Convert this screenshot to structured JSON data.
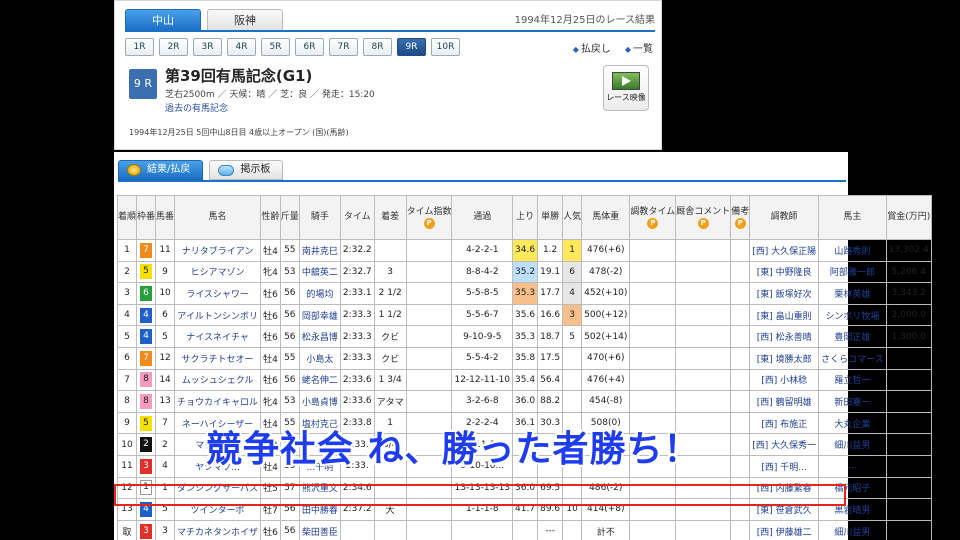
{
  "venue_tabs": [
    {
      "label": "中山",
      "active": true
    },
    {
      "label": "阪神",
      "active": false
    }
  ],
  "result_date": "1994年12月25日のレース結果",
  "race_tabs": [
    "1R",
    "2R",
    "3R",
    "4R",
    "5R",
    "6R",
    "7R",
    "8R",
    "9R",
    "10R"
  ],
  "active_race_tab": "9R",
  "links": {
    "payout": "払戻し",
    "list": "一覧"
  },
  "race": {
    "number": "9 R",
    "title": "第39回有馬記念(G1)",
    "subtitle": "芝右2500m ／ 天候：晴 ／ 芝：良 ／ 発走：15:20",
    "past_link": "過去の有馬記念",
    "info": "1994年12月25日 5回中山8日目 4歳以上オープン (国)(馬齢)"
  },
  "video_button": {
    "label": "レース映像",
    "icon": "video-thumbnail-icon"
  },
  "section_tabs": [
    {
      "label": "結果/払戻",
      "icon": "coin-icon",
      "active": true
    },
    {
      "label": "掲示板",
      "icon": "speech-bubble-icon",
      "active": false
    }
  ],
  "table": {
    "headers": [
      "着順",
      "枠番",
      "馬番",
      "馬名",
      "性齢",
      "斤量",
      "騎手",
      "タイム",
      "着差",
      "タイム指数",
      "通過",
      "上り",
      "単勝",
      "人気",
      "馬体重",
      "調教タイム",
      "厩舎コメント",
      "備考",
      "調教師",
      "馬主",
      "賞金(万円)"
    ],
    "premium_badge": "P",
    "rows": [
      [
        "1",
        "7",
        "11",
        "ナリタブライアン",
        "牡4",
        "55",
        "南井克巳",
        "2:32.2",
        "",
        "",
        "4-2-2-1",
        "34.6",
        "1.2",
        "1",
        "476(+6)",
        "",
        "",
        "",
        "[西] 大久保正陽",
        "山路秀則",
        "13,302.4"
      ],
      [
        "2",
        "5",
        "9",
        "ヒシアマゾン",
        "牝4",
        "53",
        "中舘英二",
        "2:32.7",
        "3",
        "",
        "8-8-4-2",
        "35.2",
        "19.1",
        "6",
        "478(-2)",
        "",
        "",
        "",
        "[東] 中野隆良",
        "阿部雅一郎",
        "5,266.4"
      ],
      [
        "3",
        "6",
        "10",
        "ライスシャワー",
        "牡6",
        "56",
        "的場均",
        "2:33.1",
        "2 1/2",
        "",
        "5-5-8-5",
        "35.3",
        "17.7",
        "4",
        "452(+10)",
        "",
        "",
        "",
        "[東] 飯塚好次",
        "栗林英雄",
        "3,343.2"
      ],
      [
        "4",
        "4",
        "6",
        "アイルトンシンボリ",
        "牡6",
        "56",
        "岡部幸雄",
        "2:33.3",
        "1 1/2",
        "",
        "5-5-6-7",
        "35.6",
        "16.6",
        "3",
        "500(+12)",
        "",
        "",
        "",
        "[東] 畠山重則",
        "シンボリ牧場",
        "2,000.0"
      ],
      [
        "5",
        "4",
        "5",
        "ナイスネイチャ",
        "牡6",
        "56",
        "松永昌博",
        "2:33.3",
        "クビ",
        "",
        "9-10-9-5",
        "35.3",
        "18.7",
        "5",
        "502(+14)",
        "",
        "",
        "",
        "[西] 松永善晴",
        "豊岡正雄",
        "1,300.0"
      ],
      [
        "6",
        "7",
        "12",
        "サクラチトセオー",
        "牡4",
        "55",
        "小島太",
        "2:33.3",
        "クビ",
        "",
        "5-5-4-2",
        "35.8",
        "17.5",
        "",
        "470(+6)",
        "",
        "",
        "",
        "[東] 境勝太郎",
        "さくらコマース",
        ""
      ],
      [
        "7",
        "8",
        "14",
        "ムッシュシェクル",
        "牡6",
        "56",
        "蛯名伸二",
        "2:33.6",
        "1 3/4",
        "",
        "12-12-11-10",
        "35.4",
        "56.4",
        "",
        "476(+4)",
        "",
        "",
        "",
        "[西] 小林稔",
        "羅立哲一",
        ""
      ],
      [
        "8",
        "8",
        "13",
        "チョウカイキャロル",
        "牝4",
        "53",
        "小島貞博",
        "2:33.6",
        "アタマ",
        "",
        "3-2-6-8",
        "36.0",
        "88.2",
        "",
        "454(-8)",
        "",
        "",
        "",
        "[西] 鶴留明雄",
        "新田嘉一",
        ""
      ],
      [
        "9",
        "5",
        "7",
        "ネーハイシーザー",
        "牡4",
        "55",
        "塩村克己",
        "2:33.8",
        "1",
        "",
        "2-2-2-4",
        "36.1",
        "30.3",
        "",
        "508(0)",
        "",
        "",
        "",
        "[西] 布施正",
        "大丸企業",
        ""
      ],
      [
        "10",
        "2",
        "2",
        "マチカネ...",
        "牡4",
        "55",
        "...",
        "2:33.",
        "3/4",
        "",
        "11-11-1...",
        "",
        "",
        "",
        "",
        "",
        "",
        "",
        "[西] 大久保秀一",
        "細川益男",
        ""
      ],
      [
        "11",
        "3",
        "4",
        "ヤシマソ...",
        "牡4",
        "55",
        "...千明",
        "2:33.",
        "",
        "",
        "9-10-10...",
        "",
        "",
        "",
        "",
        "",
        "",
        "",
        "[西] 千明...",
        "...",
        ""
      ],
      [
        "12",
        "1",
        "1",
        "ダンシングサーパス",
        "牡5",
        "57",
        "熊沢重文",
        "2:34.6",
        "",
        "",
        "13-13-13-13",
        "36.0",
        "69.5",
        "",
        "486(-2)",
        "",
        "",
        "",
        "[西] 内藤繁春",
        "橋元昭子",
        ""
      ],
      [
        "13",
        "4",
        "5",
        "ツインターボ",
        "牡7",
        "56",
        "田中勝春",
        "2:37.2",
        "大",
        "",
        "1-1-1-8",
        "41.7",
        "89.6",
        "10",
        "414(+8)",
        "",
        "",
        "",
        "[東] 笹倉武久",
        "黒岩晴男",
        ""
      ],
      [
        "取",
        "3",
        "3",
        "マチカネタンホイザ",
        "牡6",
        "56",
        "柴田善臣",
        "",
        "",
        "",
        "",
        "",
        "---",
        "",
        "計不",
        "",
        "",
        "",
        "[西] 伊藤雄二",
        "細川益男",
        ""
      ]
    ]
  },
  "highlights": {
    "up_top": "#ffe85a",
    "up_blue": "#bde0ff",
    "up_orange": "#f6be8a"
  },
  "overlay_caption": "競争社会 ね、勝った者勝ち！",
  "colors": {
    "accent": "#1c70c8",
    "highlight_box": "#e2261c",
    "caption": "#1e3cf0"
  }
}
